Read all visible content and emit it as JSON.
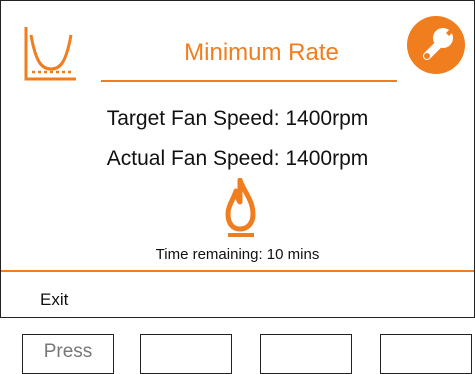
{
  "screen": {
    "title": "Minimum Rate",
    "target_fan_speed": "Target Fan Speed: 1400rpm",
    "actual_fan_speed": "Actual Fan Speed: 1400rpm",
    "time_remaining": "Time remaining: 10 mins",
    "exit_label": "Exit"
  },
  "softkeys": {
    "key1_label": "Press",
    "key2_label": "",
    "key3_label": "",
    "key4_label": ""
  },
  "colors": {
    "accent": "#f07d1e",
    "frame": "#222222",
    "text": "#111111"
  },
  "icons": {
    "rate_icon": "minimum-rate-curve-icon",
    "settings_icon": "wrench-icon",
    "flame_icon": "flame-icon"
  }
}
